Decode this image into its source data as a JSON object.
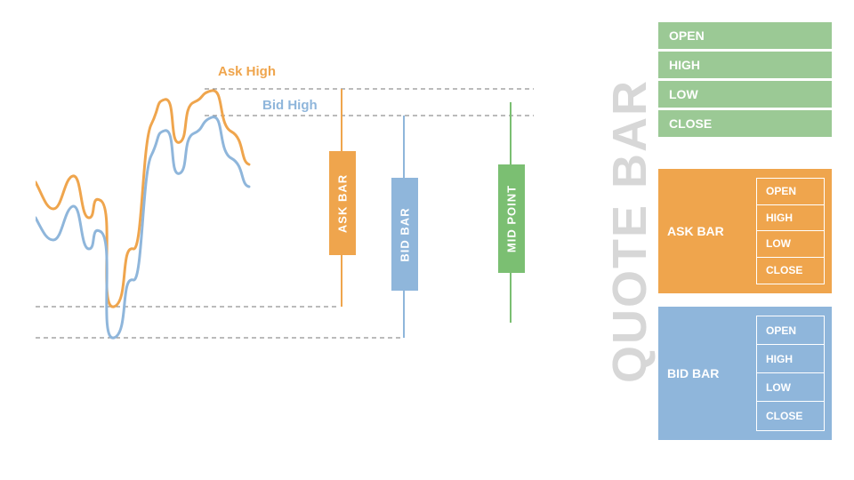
{
  "colors": {
    "ask": "#efa54d",
    "bid": "#8fb6db",
    "mid": "#7bbf72",
    "dash": "#777",
    "quote_label": "#d7d7d7"
  },
  "quote_bar_label": "QUOTE BAR",
  "ohlc_fields": [
    "OPEN",
    "HIGH",
    "LOW",
    "CLOSE"
  ],
  "panels": {
    "top": {
      "rows": [
        "OPEN",
        "HIGH",
        "LOW",
        "CLOSE"
      ]
    },
    "mid": {
      "label": "ASK BAR",
      "rows": [
        "OPEN",
        "HIGH",
        "LOW",
        "CLOSE"
      ]
    },
    "bot": {
      "label": "BID BAR",
      "rows": [
        "OPEN",
        "HIGH",
        "LOW",
        "CLOSE"
      ]
    }
  },
  "annotations": {
    "ask_high": "Ask High",
    "bid_high": "Bid High"
  },
  "bars": {
    "ask": {
      "label": "ASK BAR"
    },
    "bid": {
      "label": "BID BAR"
    },
    "mid": {
      "label": "MID POINT"
    }
  },
  "chart_data": {
    "type": "line",
    "title": "",
    "xlabel": "",
    "ylabel": "",
    "xlim": [
      0,
      200
    ],
    "ylim": [
      0,
      350
    ],
    "series": [
      {
        "name": "Ask",
        "color": "#efa54d",
        "x": [
          0,
          15,
          30,
          45,
          55,
          70,
          85,
          100,
          120,
          140,
          155,
          175,
          195,
          215,
          235
        ],
        "y": [
          135,
          165,
          125,
          175,
          150,
          275,
          210,
          75,
          40,
          90,
          45,
          65,
          30,
          75,
          115
        ],
        "annotation": "Ask High",
        "high_index": 12
      },
      {
        "name": "Bid",
        "color": "#8fb6db",
        "x": [
          0,
          15,
          30,
          45,
          55,
          70,
          85,
          100,
          120,
          140,
          155,
          175,
          195,
          215,
          235
        ],
        "y": [
          175,
          200,
          160,
          210,
          185,
          310,
          245,
          110,
          75,
          125,
          80,
          100,
          60,
          105,
          140
        ],
        "annotation": "Bid High",
        "high_index": 12
      }
    ],
    "candlesticks": [
      {
        "name": "ASK BAR",
        "color": "#efa54d",
        "wick_top": 30,
        "wick_bottom": 275,
        "body_top": 100,
        "body_bottom": 215
      },
      {
        "name": "BID BAR",
        "color": "#8fb6db",
        "wick_top": 60,
        "wick_bottom": 310,
        "body_top": 130,
        "body_bottom": 255
      },
      {
        "name": "MID POINT",
        "color": "#7bbf72",
        "wick_top": 45,
        "wick_bottom": 293,
        "body_top": 115,
        "body_bottom": 235
      }
    ],
    "reference_lines": [
      {
        "y": 30,
        "from": "ask_high",
        "style": "dashed"
      },
      {
        "y": 60,
        "from": "bid_high",
        "style": "dashed"
      },
      {
        "y": 275,
        "from": "ask_low",
        "style": "dashed"
      },
      {
        "y": 310,
        "from": "bid_low",
        "style": "dashed"
      }
    ]
  }
}
